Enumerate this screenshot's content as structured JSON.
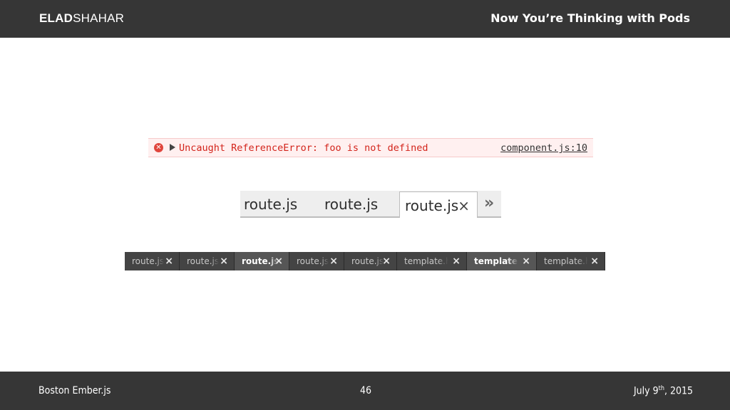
{
  "header": {
    "brand_bold": "ELAD",
    "brand_light": "SHAHAR",
    "title": "Now You’re Thinking with Pods"
  },
  "error_line": {
    "icon": "error-circle-icon",
    "message": "Uncaught ReferenceError: foo is not defined",
    "source": "component.js:10"
  },
  "light_tabs": {
    "tabs": [
      "route.js",
      "route.js",
      "route.js"
    ],
    "close_glyph": "×",
    "overflow_glyph": "»"
  },
  "dark_tabs": {
    "tabs": [
      "route.js",
      "route.js",
      "route.js",
      "route.js",
      "route.js",
      "template.hbs",
      "template.hbs",
      "template.hbs"
    ],
    "close_glyph": "×"
  },
  "footer": {
    "event": "Boston Ember.js",
    "page": "46",
    "date_prefix": "July 9",
    "date_sup": "th",
    "date_suffix": ", 2015"
  }
}
